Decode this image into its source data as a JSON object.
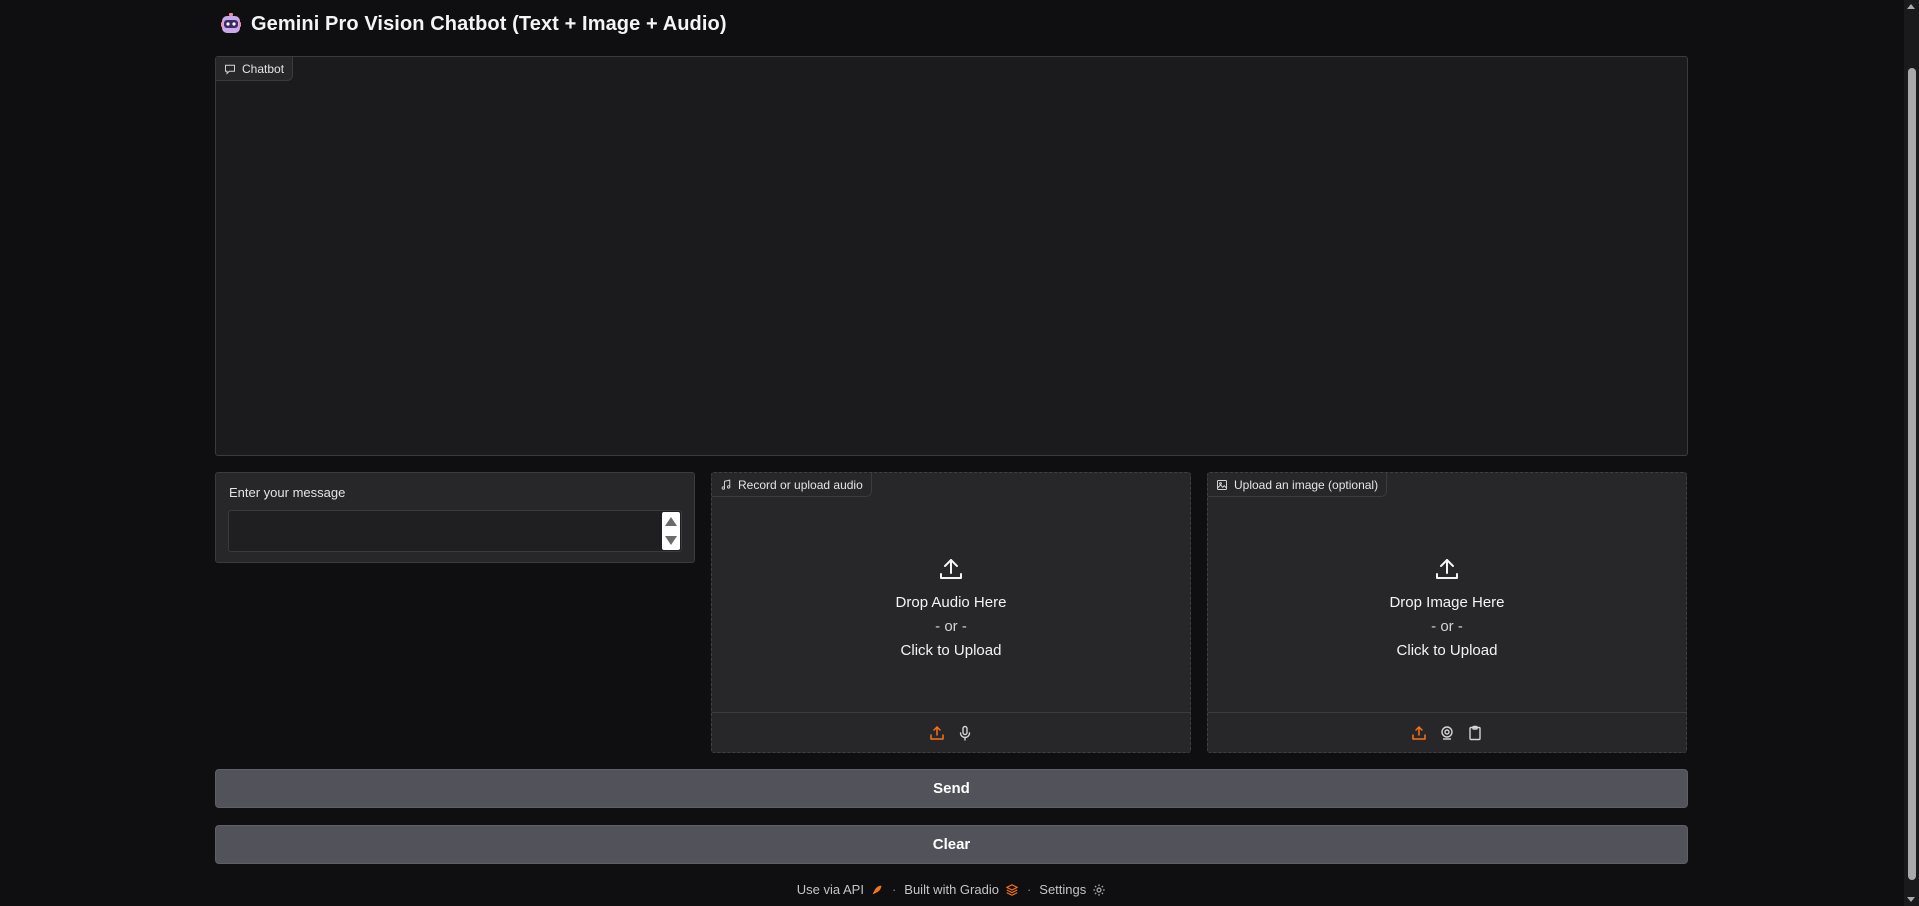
{
  "header": {
    "title": "Gemini Pro Vision Chatbot (Text + Image + Audio)",
    "icon": "robot-emoji-icon"
  },
  "chatbot": {
    "label": "Chatbot",
    "icon": "chat-icon"
  },
  "message": {
    "label": "Enter your message",
    "value": "",
    "placeholder": ""
  },
  "audio_upload": {
    "label": "Record or upload audio",
    "icon": "music-note-icon",
    "drop_text": "Drop Audio Here",
    "or_text": "- or -",
    "click_text": "Click to Upload",
    "sources": [
      "upload-icon",
      "microphone-icon"
    ]
  },
  "image_upload": {
    "label": "Upload an image (optional)",
    "icon": "image-icon",
    "drop_text": "Drop Image Here",
    "or_text": "- or -",
    "click_text": "Click to Upload",
    "sources": [
      "upload-icon",
      "webcam-icon",
      "clipboard-icon"
    ]
  },
  "buttons": {
    "send": "Send",
    "clear": "Clear"
  },
  "footer": {
    "api": "Use via API",
    "built": "Built with Gradio",
    "settings": "Settings",
    "separator": "·"
  },
  "colors": {
    "background": "#0f0f11",
    "panel": "#27272a",
    "button": "#52525b",
    "accent": "#f97316"
  }
}
